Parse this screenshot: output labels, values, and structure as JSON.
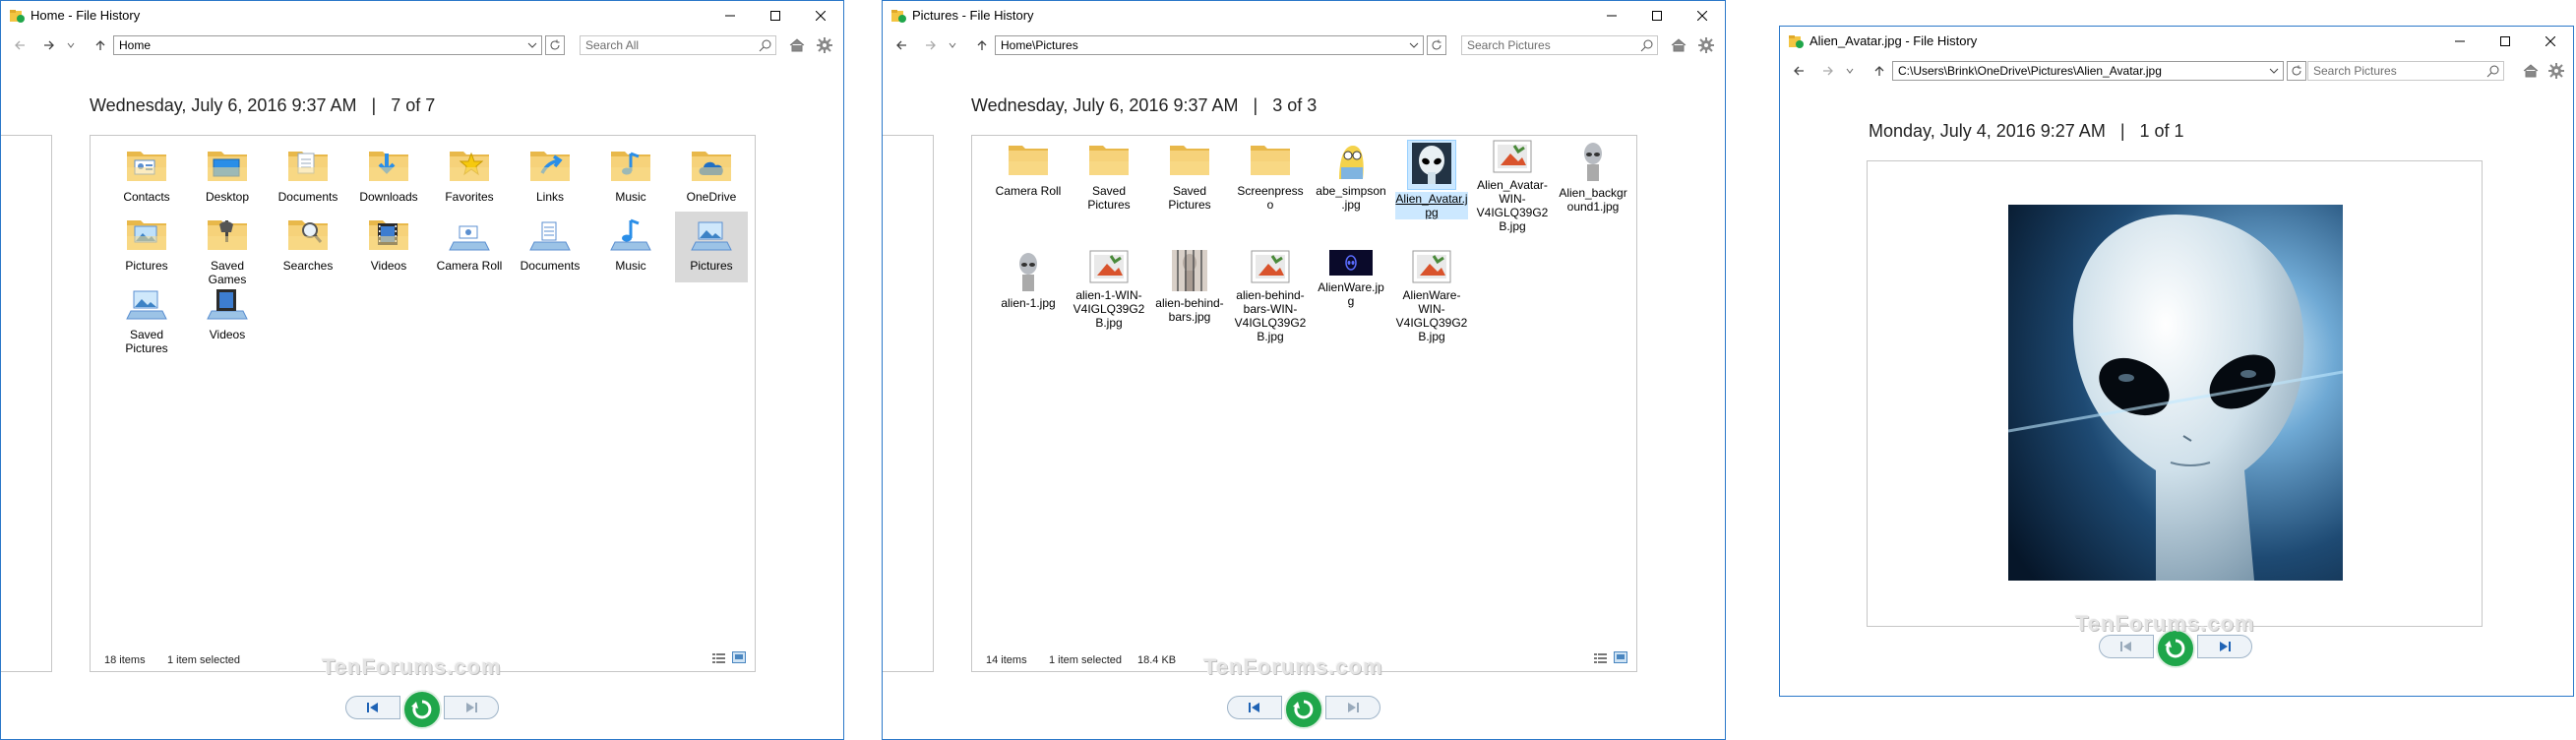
{
  "colors": {
    "accent": "#2b78c9",
    "restore": "#1fa64a",
    "selection": "#cce8ff",
    "folder": "#f4c542"
  },
  "watermark": "TenForums.com",
  "windows": [
    {
      "title": "Home - File History",
      "address": "Home",
      "search_placeholder": "Search All",
      "header": {
        "date": "Wednesday, July 6, 2016 9:37 AM",
        "sep": "|",
        "count": "7 of 7"
      },
      "status": {
        "items": "18 items",
        "selected": "1 item selected",
        "size": ""
      },
      "items": [
        {
          "label": "Contacts",
          "icon": "contacts-folder-icon"
        },
        {
          "label": "Desktop",
          "icon": "desktop-folder-icon"
        },
        {
          "label": "Documents",
          "icon": "documents-folder-icon"
        },
        {
          "label": "Downloads",
          "icon": "downloads-folder-icon"
        },
        {
          "label": "Favorites",
          "icon": "favorites-folder-icon"
        },
        {
          "label": "Links",
          "icon": "links-folder-icon"
        },
        {
          "label": "Music",
          "icon": "music-folder-icon"
        },
        {
          "label": "OneDrive",
          "icon": "onedrive-folder-icon"
        },
        {
          "label": "Pictures",
          "icon": "pictures-folder-icon"
        },
        {
          "label": "Saved Games",
          "icon": "saved-games-folder-icon"
        },
        {
          "label": "Searches",
          "icon": "searches-folder-icon"
        },
        {
          "label": "Videos",
          "icon": "videos-folder-icon"
        },
        {
          "label": "Camera Roll",
          "icon": "camera-roll-library-icon"
        },
        {
          "label": "Documents",
          "icon": "documents-library-icon"
        },
        {
          "label": "Music",
          "icon": "music-library-icon"
        },
        {
          "label": "Pictures",
          "icon": "pictures-library-icon",
          "selected": true
        },
        {
          "label": "Saved Pictures",
          "icon": "saved-pictures-library-icon"
        },
        {
          "label": "Videos",
          "icon": "videos-library-icon"
        }
      ]
    },
    {
      "title": "Pictures - File History",
      "address": "Home\\Pictures",
      "search_placeholder": "Search Pictures",
      "header": {
        "date": "Wednesday, July 6, 2016 9:37 AM",
        "sep": "|",
        "count": "3 of 3"
      },
      "status": {
        "items": "14 items",
        "selected": "1 item selected",
        "size": "18.4 KB"
      },
      "items": [
        {
          "label": "Camera Roll",
          "icon": "folder-icon"
        },
        {
          "label": "Saved Pictures",
          "icon": "folder-icon"
        },
        {
          "label": "Saved Pictures",
          "icon": "folder-icon"
        },
        {
          "label": "Screenpresso",
          "icon": "folder-icon"
        },
        {
          "label": "abe_simpson.jpg",
          "icon": "simpson-thumbnail-icon"
        },
        {
          "label": "Alien_Avatar.jpg",
          "icon": "alien-avatar-thumbnail-icon",
          "selected": true
        },
        {
          "label": "Alien_Avatar-WIN-V4IGLQ39G2B.jpg",
          "icon": "broken-image-icon"
        },
        {
          "label": "Alien_background1.jpg",
          "icon": "alien-thumbnail-icon"
        },
        {
          "label": "alien-1.jpg",
          "icon": "alien-thumbnail-icon"
        },
        {
          "label": "alien-1-WIN-V4IGLQ39G2B.jpg",
          "icon": "broken-image-icon"
        },
        {
          "label": "alien-behind-bars.jpg",
          "icon": "alien-bars-thumbnail-icon"
        },
        {
          "label": "alien-behind-bars-WIN-V4IGLQ39G2B.jpg",
          "icon": "broken-image-icon"
        },
        {
          "label": "AlienWare.jpg",
          "icon": "alienware-thumbnail-icon"
        },
        {
          "label": "AlienWare-WIN-V4IGLQ39G2B.jpg",
          "icon": "broken-image-icon"
        }
      ]
    },
    {
      "title": "Alien_Avatar.jpg - File History",
      "address": "C:\\Users\\Brink\\OneDrive\\Pictures\\Alien_Avatar.jpg",
      "search_placeholder": "Search Pictures",
      "header": {
        "date": "Monday, July 4, 2016 9:27 AM",
        "sep": "|",
        "count": "1 of 1"
      },
      "preview_icon": "alien-avatar-image"
    }
  ]
}
